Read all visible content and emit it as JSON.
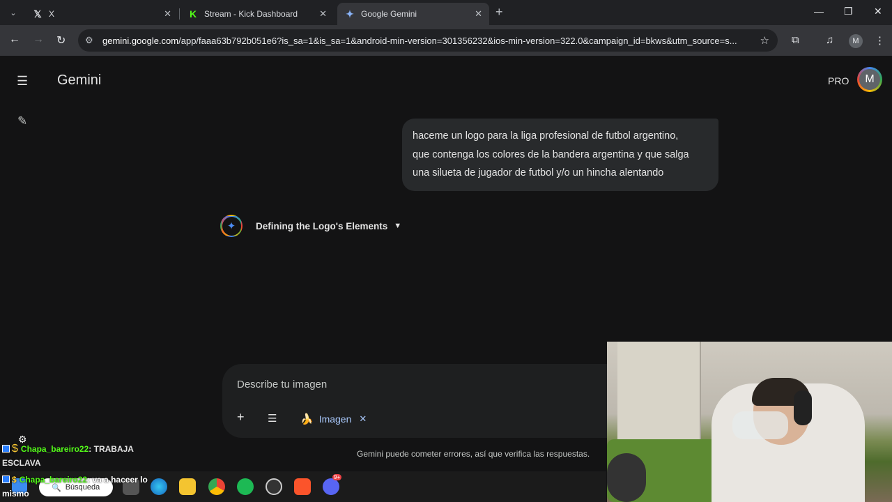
{
  "browser": {
    "tabs": [
      {
        "title": "X",
        "favicon": "x-icon"
      },
      {
        "title": "Stream - Kick Dashboard",
        "favicon": "kick-icon"
      },
      {
        "title": "Google Gemini",
        "favicon": "gemini-icon",
        "active": true
      }
    ],
    "url_host": "gemini.google.com",
    "url_rest": "/app/faaa63b792b051e6?is_sa=1&is_sa=1&android-min-version=301356232&ios-min-version=322.0&campaign_id=bkws&utm_source=s...",
    "profile_initial": "M"
  },
  "app": {
    "brand": "Gemini",
    "plan_badge": "PRO",
    "avatar_initial": "M"
  },
  "conversation": {
    "user_message_lines": [
      "haceme un logo para la liga profesional de futbol argentino,",
      "que contenga los colores de la bandera argentina y que salga",
      "una silueta de jugador de futbol y/o un hincha alentando"
    ],
    "thinking_label": "Defining the Logo's Elements"
  },
  "composer": {
    "placeholder": "Describe tu imagen",
    "tool_chip": "Imagen"
  },
  "disclaimer": "Gemini puede cometer errores, así que verifica las respuestas.",
  "stream_chat": [
    {
      "user": "Chapa_bareiro22",
      "message": ": TRABAJA",
      "continuation": "ESCLAVA"
    },
    {
      "user": "Chapa_bareiro22",
      "message": ": va a haceer lo",
      "continuation": "mismo"
    }
  ],
  "taskbar": {
    "search_label": "Búsqueda",
    "discord_badge": "9+"
  },
  "colors": {
    "app_bg": "#131314",
    "bubble_bg": "#282a2c",
    "accent_blue": "#a8c7fa",
    "chat_username": "#53fc18"
  }
}
